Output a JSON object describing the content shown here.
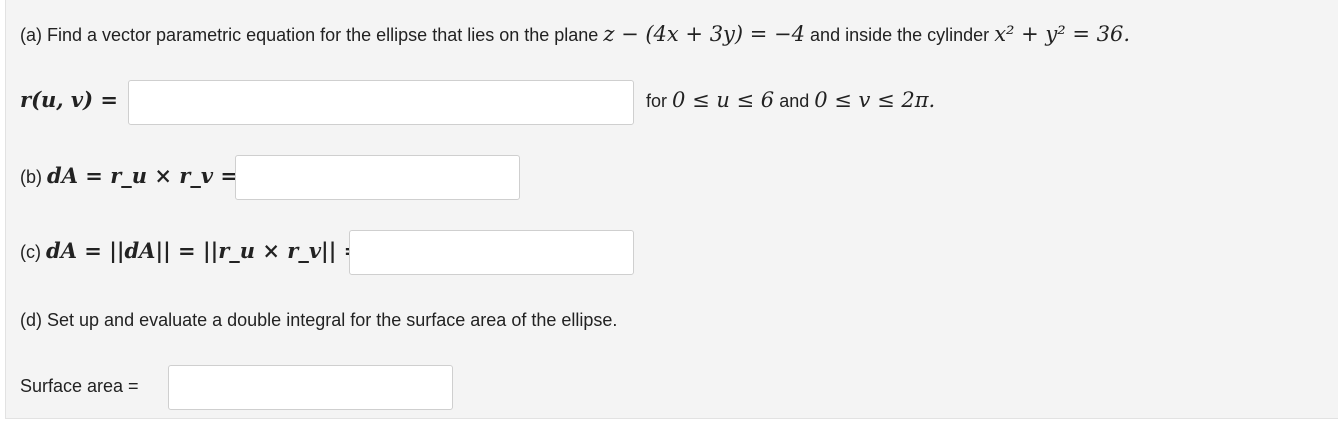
{
  "part_a": {
    "prompt_pre": "(a) Find a vector parametric equation for the ellipse that lies on the plane",
    "plane_eq": "z − (4x + 3y) = −4",
    "connector": "and inside the cylinder",
    "cylinder_eq": "x² + y² = 36.",
    "r_label": "r(u, v) =",
    "range_for": "for",
    "u_range": "0 ≤ u ≤ 6",
    "range_and": "and",
    "v_range": "0 ≤ v ≤ 2π."
  },
  "part_b": {
    "label": "(b)",
    "expr": "dA = r_u × r_v ="
  },
  "part_c": {
    "label": "(c)",
    "expr": "dA = ||dA|| = ||r_u × r_v|| ="
  },
  "part_d": {
    "prompt": "(d) Set up and evaluate a double integral for the surface area of the ellipse.",
    "surface_label": "Surface area ="
  },
  "inputs": {
    "r_value": "",
    "dA_vec_value": "",
    "dA_value": "",
    "surface_area_value": ""
  }
}
